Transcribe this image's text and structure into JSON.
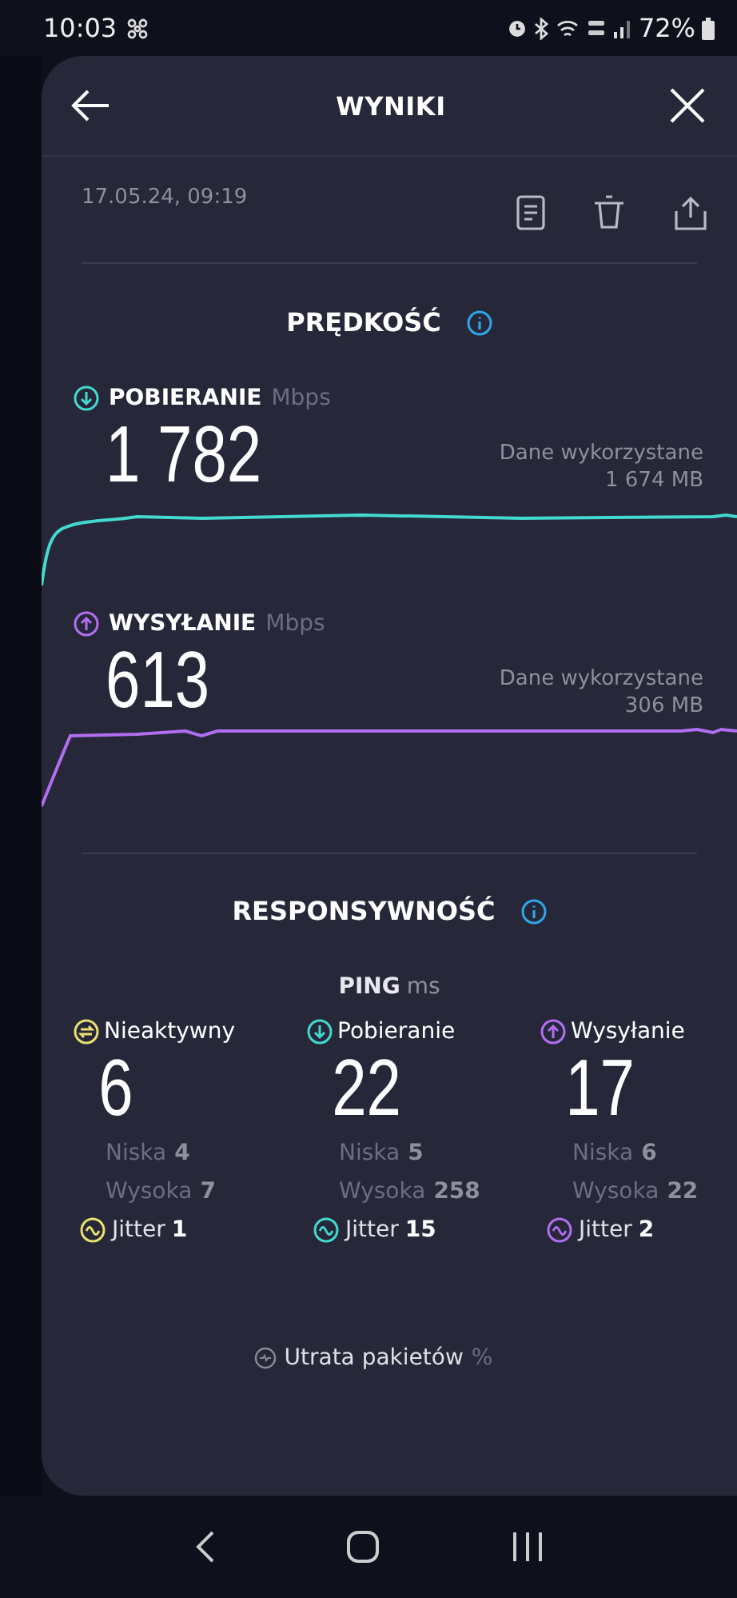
{
  "status_bar": {
    "time": "10:03",
    "battery": "72%"
  },
  "header": {
    "title": "WYNIKI"
  },
  "date": "17.05.24, 09:19",
  "speed": {
    "title": "PRĘDKOŚĆ",
    "metrics": [
      {
        "kind": "download",
        "label": "POBIERANIE",
        "unit": "Mbps",
        "value": "1 782",
        "data_label": "Dane wykorzystane",
        "data_value": "1 674 MB",
        "color": "#43d9cf"
      },
      {
        "kind": "upload",
        "label": "WYSYŁANIE",
        "unit": "Mbps",
        "value": "613",
        "data_label": "Dane wykorzystane",
        "data_value": "306 MB",
        "color": "#b16ef2"
      }
    ]
  },
  "responsiveness": {
    "title": "RESPONSYWNOŚĆ",
    "ping": {
      "label": "PING",
      "unit": "ms"
    },
    "columns": [
      {
        "kind": "idle",
        "label": "Nieaktywny",
        "value": "6",
        "low_label": "Niska",
        "low": "4",
        "high_label": "Wysoka",
        "high": "7",
        "jitter_label": "Jitter",
        "jitter": "1",
        "color": "#eadf6e"
      },
      {
        "kind": "download",
        "label": "Pobieranie",
        "value": "22",
        "low_label": "Niska",
        "low": "5",
        "high_label": "Wysoka",
        "high": "258",
        "jitter_label": "Jitter",
        "jitter": "15",
        "color": "#43d9cf"
      },
      {
        "kind": "upload",
        "label": "Wysyłanie",
        "value": "17",
        "low_label": "Niska",
        "low": "6",
        "high_label": "Wysoka",
        "high": "22",
        "jitter_label": "Jitter",
        "jitter": "2",
        "color": "#b16ef2"
      }
    ]
  },
  "packet_loss": {
    "label": "Utrata pakietów",
    "unit": "%"
  }
}
